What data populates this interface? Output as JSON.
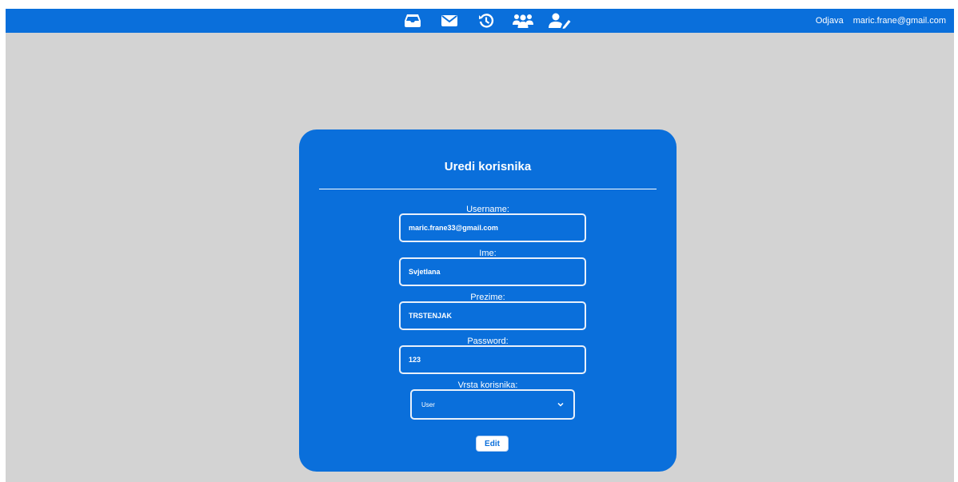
{
  "header": {
    "nav_icons": [
      "inbox-icon",
      "envelope-icon",
      "history-icon",
      "users-icon",
      "user-edit-icon"
    ],
    "logout_label": "Odjava",
    "user_email": "maric.frane@gmail.com"
  },
  "form": {
    "title": "Uredi korisnika",
    "fields": [
      {
        "label": "Username:",
        "value": "maric.frane33@gmail.com"
      },
      {
        "label": "Ime:",
        "value": "Svjetlana"
      },
      {
        "label": "Prezime:",
        "value": "TRSTENJAK"
      },
      {
        "label": "Password:",
        "value": "123"
      }
    ],
    "user_type_label": "Vrsta korisnika:",
    "user_type_selected": "User",
    "submit_label": "Edit"
  },
  "colors": {
    "primary": "#0a6fdb",
    "background": "#d3d3d3",
    "text_on_primary": "#ffffff"
  }
}
